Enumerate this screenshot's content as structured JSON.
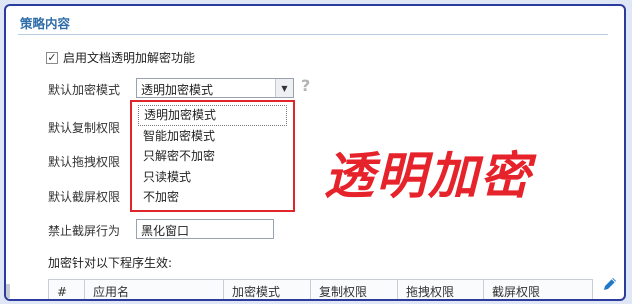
{
  "section": {
    "title": "策略内容"
  },
  "enable_checkbox": {
    "checked": true,
    "check_glyph": "✓",
    "label": "启用文档透明加解密功能"
  },
  "rows": {
    "encrypt_mode_label": "默认加密模式",
    "copy_perm_label": "默认复制权限",
    "drag_perm_label": "默认拖拽权限",
    "screenshot_perm_label": "默认截屏权限",
    "block_screenshot_label": "禁止截屏行为"
  },
  "encrypt_mode_select": {
    "value": "透明加密模式",
    "arrow": "▼"
  },
  "block_screenshot_select": {
    "value": "黑化窗口"
  },
  "help_icon": {
    "glyph": "?"
  },
  "dropdown": {
    "options": [
      "透明加密模式",
      "智能加密模式",
      "只解密不加密",
      "只读模式",
      "不加密"
    ],
    "selected_index": 0
  },
  "watermark": {
    "text": "透明加密"
  },
  "table": {
    "label": "加密针对以下程序生效:",
    "columns": [
      "#",
      "应用名",
      "加密模式",
      "复制权限",
      "拖拽权限",
      "截屏权限"
    ]
  },
  "colors": {
    "accent": "#2f6ea8",
    "highlight_border": "#e0262b",
    "panel_border": "#2c3c9e",
    "edit_icon": "#1f78c8"
  }
}
